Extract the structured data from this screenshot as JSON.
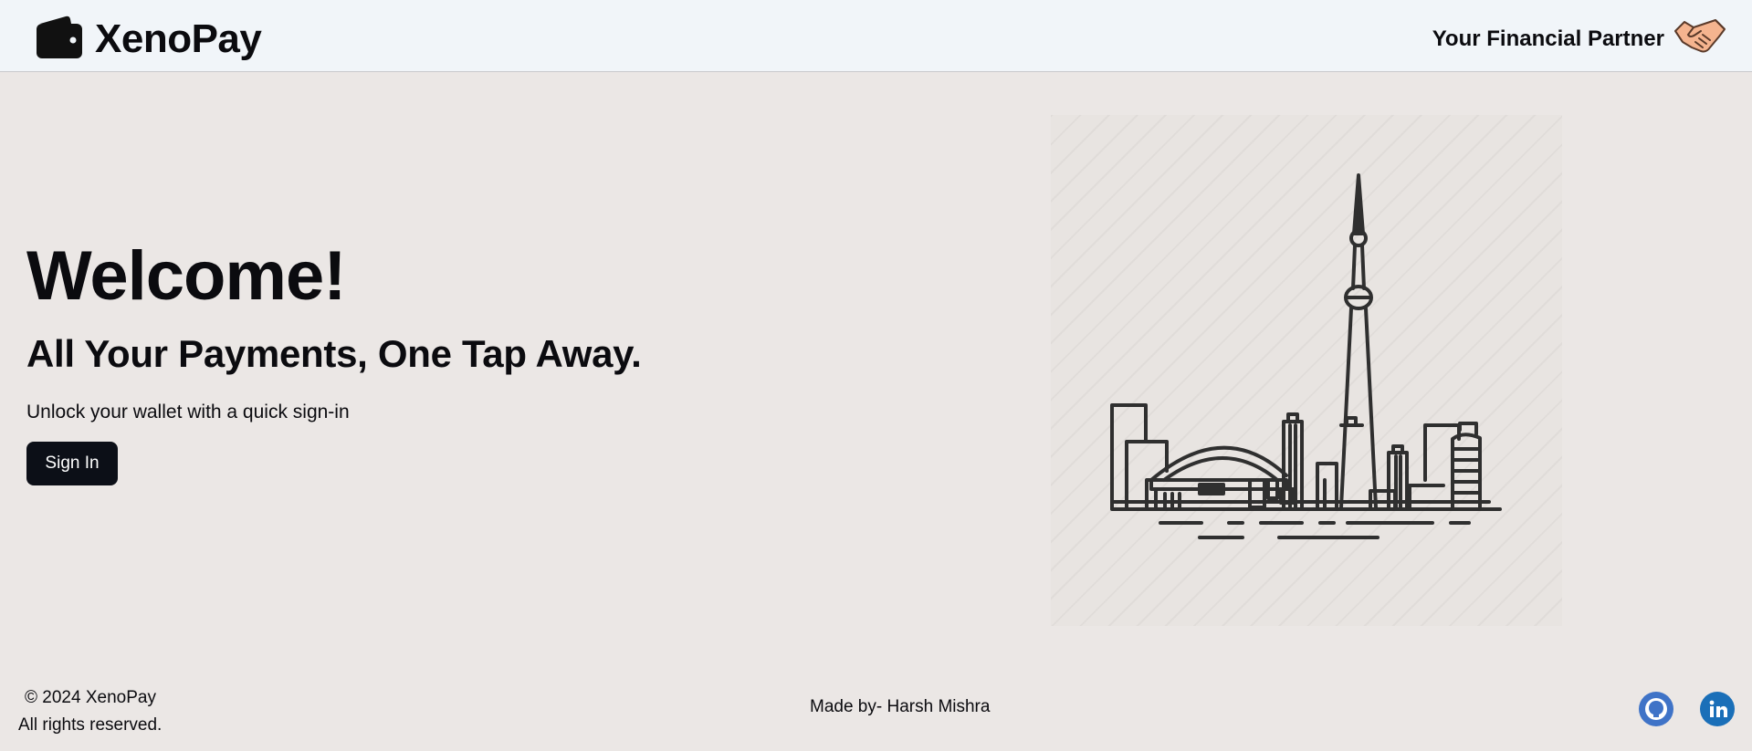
{
  "header": {
    "brand_name": "XenoPay",
    "tagline": "Your Financial Partner",
    "icons": {
      "logo": "wallet-icon",
      "tagline": "handshake-icon"
    }
  },
  "hero": {
    "title": "Welcome!",
    "subtitle": "All Your Payments, One Tap Away.",
    "description": "Unlock your wallet with a quick sign-in",
    "signin_label": "Sign In"
  },
  "illustration": {
    "icon": "city-skyline-illustration"
  },
  "footer": {
    "copyright": "© 2024 XenoPay",
    "rights": "All rights reserved.",
    "credit": "Made by- Harsh Mishra",
    "social": [
      "github-icon",
      "linkedin-icon"
    ]
  },
  "colors": {
    "background": "#ebe7e5",
    "header_bg": "#f1f5f9",
    "button_bg": "#0c0f17",
    "github": "#3f73c7",
    "linkedin": "#1a6fb8"
  }
}
